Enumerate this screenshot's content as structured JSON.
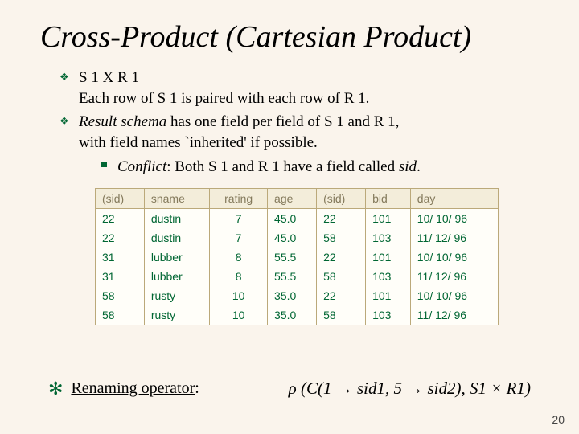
{
  "title": "Cross-Product (Cartesian Product)",
  "b1": {
    "line1": "S 1 X R 1",
    "line2": "Each row of S 1 is paired with each row of R 1."
  },
  "b2": {
    "schema": "Result schema",
    "rest": " has one field per field of S 1 and R 1,",
    "line2": "with field names `inherited' if possible.",
    "conflict_label": "Conflict",
    "conflict_rest": ":  Both S 1 and R 1 have a field called ",
    "sid": "sid"
  },
  "headers": {
    "c0": "(sid)",
    "c1": "sname",
    "c2": "rating",
    "c3": "age",
    "c4": "(sid)",
    "c5": "bid",
    "c6": "day"
  },
  "rows": {
    "r0": {
      "c0": "22",
      "c1": "dustin",
      "c2": "7",
      "c3": "45.0",
      "c4": "22",
      "c5": "101",
      "c6": "10/ 10/ 96"
    },
    "r1": {
      "c0": "22",
      "c1": "dustin",
      "c2": "7",
      "c3": "45.0",
      "c4": "58",
      "c5": "103",
      "c6": "11/ 12/ 96"
    },
    "r2": {
      "c0": "31",
      "c1": "lubber",
      "c2": "8",
      "c3": "55.5",
      "c4": "22",
      "c5": "101",
      "c6": "10/ 10/ 96"
    },
    "r3": {
      "c0": "31",
      "c1": "lubber",
      "c2": "8",
      "c3": "55.5",
      "c4": "58",
      "c5": "103",
      "c6": "11/ 12/ 96"
    },
    "r4": {
      "c0": "58",
      "c1": "rusty",
      "c2": "10",
      "c3": "35.0",
      "c4": "22",
      "c5": "101",
      "c6": "10/ 10/ 96"
    },
    "r5": {
      "c0": "58",
      "c1": "rusty",
      "c2": "10",
      "c3": "35.0",
      "c4": "58",
      "c5": "103",
      "c6": "11/ 12/ 96"
    }
  },
  "footer": {
    "label": "Renaming operator",
    "colon": ":",
    "formula": "ρ (C(1 → sid1, 5 → sid2), S1 × R1)"
  },
  "pagenum": "20"
}
